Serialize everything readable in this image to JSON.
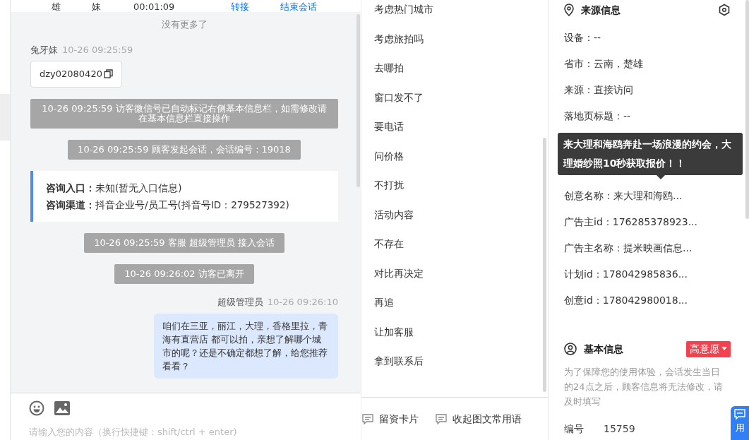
{
  "chat_header": {
    "cells": [
      "雄",
      "妹",
      "00:01:09"
    ],
    "links": [
      "转接",
      "结束会话"
    ]
  },
  "chat": {
    "no_more": "没有更多了",
    "messages": [
      {
        "kind": "visitor",
        "sender": "兔牙妹",
        "time": "10-26 09:25:59",
        "text": "dzy02080420"
      },
      {
        "kind": "system",
        "text": "10-26 09:25:59 访客微信号已自动标记右侧基本信息栏，如需修改请在基本信息栏直接操作"
      },
      {
        "kind": "system",
        "text": "10-26 09:25:59 顾客发起会话，会话编号：19018"
      },
      {
        "kind": "entry",
        "rows": [
          {
            "label": "咨询入口：",
            "value": "未知(暂无入口信息)"
          },
          {
            "label": "咨询渠道：",
            "value": "抖音企业号/员工号(抖音号ID：279527392)"
          }
        ]
      },
      {
        "kind": "system",
        "text": "10-26 09:25:59 客服 超级管理员 接入会话"
      },
      {
        "kind": "system",
        "text": "10-26 09:26:02 访客已离开"
      },
      {
        "kind": "agent",
        "sender": "超级管理员",
        "time": "10-26 09:26:10",
        "text": "咱们在三亚，丽江，大理，香格里拉，青海有直营店 都可以拍，亲想了解哪个城市的呢？还是不确定都想了解，给您推荐看看？"
      }
    ]
  },
  "composer": {
    "placeholder": "请输入您的内容（换行快捷键：shift/ctrl + enter)"
  },
  "quick_phrases": {
    "items": [
      "考虑热门城市",
      "考虑旅拍吗",
      "去哪拍",
      "窗口发不了",
      "要电话",
      "问价格",
      "不打扰",
      "活动内容",
      "不存在",
      "对比再决定",
      "再追",
      "让加客服",
      "拿到联系后"
    ],
    "actions": [
      "留资卡片",
      "收起图文常用语"
    ]
  },
  "source_info": {
    "title": "来源信息",
    "rows": [
      "设备：--",
      "省市：云南，楚雄",
      "来源：直接访问",
      "落地页标题：--",
      "创意名称：来大理和海鸥...",
      "广告主id：176285378923...",
      "广告主名称：提米映画信息...",
      "计划id：178042985836...",
      "创意id：178042980018..."
    ]
  },
  "tooltip": {
    "text": "来大理和海鸥奔赴一场浪漫的约会，大理婚纱照10秒获取报价！！"
  },
  "basic_info": {
    "title": "基本信息",
    "intent": "高意愿",
    "notice": "为了保障您的使用体验，会话发生当日的24点之后，顾客信息将无法修改，请及时填写",
    "fields": [
      {
        "label": "编号",
        "value": "15759"
      }
    ]
  },
  "float_button": {
    "label": "用"
  }
}
